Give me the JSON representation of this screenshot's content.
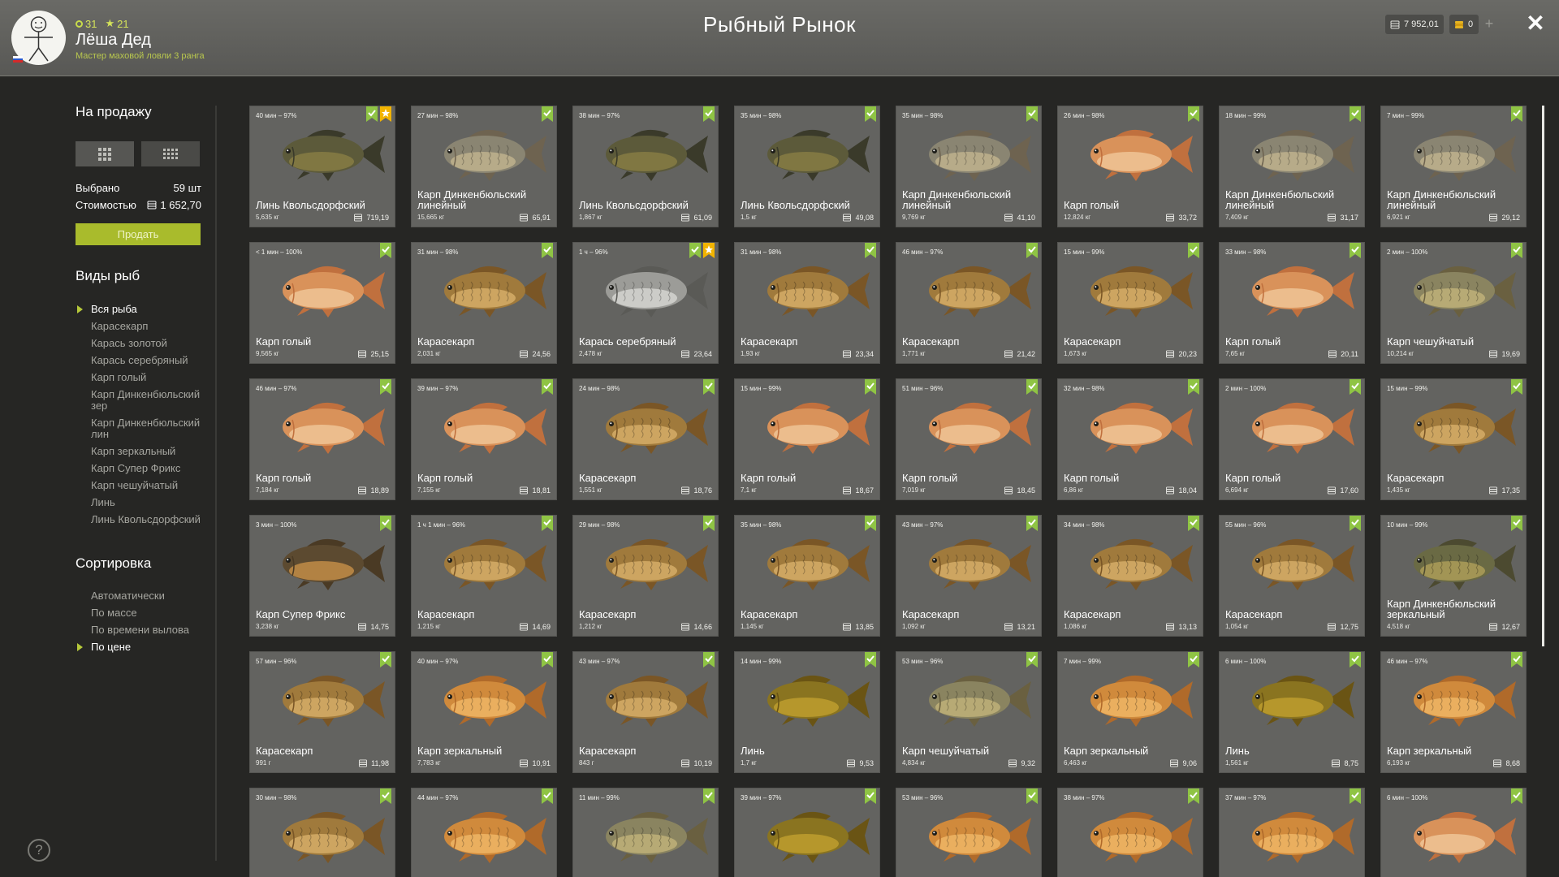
{
  "player": {
    "level": "31",
    "stars": "21",
    "name": "Лёша Дед",
    "rank": "Мастер маховой ловли 3 ранга"
  },
  "page_title": "Рыбный Рынок",
  "currency": {
    "money": "7 952,01",
    "gold": "0",
    "plus": "+"
  },
  "close": "✕",
  "sale": {
    "heading": "На продажу",
    "selected_label": "Выбрано",
    "selected_value": "59 шт",
    "cost_label": "Стоимостью",
    "cost_value": "1 652,70",
    "sell_label": "Продать"
  },
  "species": {
    "heading": "Виды рыб",
    "items": [
      "Вся рыба",
      "Карасекарп",
      "Карась золотой",
      "Карась серебряный",
      "Карп голый",
      "Карп Динкенбюльский зер",
      "Карп Динкенбюльский лин",
      "Карп зеркальный",
      "Карп Супер Фрикс",
      "Карп чешуйчатый",
      "Линь",
      "Линь Квольсдорфский"
    ],
    "active": "Вся рыба"
  },
  "sort": {
    "heading": "Сортировка",
    "items": [
      "Автоматически",
      "По массе",
      "По времени вылова",
      "По цене"
    ],
    "active": "По цене"
  },
  "help": "?",
  "icons": {
    "coin": "coin-stack-icon",
    "bookmark": "green-bookmark-icon",
    "favorite": "gold-star-bookmark-icon",
    "help": "help-icon",
    "close": "close-icon"
  },
  "colors": {
    "accent_green": "#a9bb2c",
    "bookmark_green": "#8fc444",
    "favorite_gold": "#f2b400",
    "card_bg": "#636360"
  },
  "fish": [
    {
      "age": "40 мин – 97%",
      "name": "Линь Квольсдорфский",
      "weight": "5,635 кг",
      "price": "719,19",
      "kind": "tench",
      "fav": true
    },
    {
      "age": "27 мин – 98%",
      "name": "Карп Динкенбюльский линейный",
      "weight": "15,665 кг",
      "price": "65,91",
      "kind": "mirrorgray",
      "fav": false
    },
    {
      "age": "38 мин – 97%",
      "name": "Линь Квольсдорфский",
      "weight": "1,867 кг",
      "price": "61,09",
      "kind": "tench",
      "fav": false
    },
    {
      "age": "35 мин – 98%",
      "name": "Линь Квольсдорфский",
      "weight": "1,5 кг",
      "price": "49,08",
      "kind": "tench",
      "fav": false
    },
    {
      "age": "35 мин – 98%",
      "name": "Карп Динкенбюльский линейный",
      "weight": "9,769 кг",
      "price": "41,10",
      "kind": "mirrorgray",
      "fav": false
    },
    {
      "age": "26 мин – 98%",
      "name": "Карп голый",
      "weight": "12,824 кг",
      "price": "33,72",
      "kind": "naked",
      "fav": false
    },
    {
      "age": "18 мин – 99%",
      "name": "Карп Динкенбюльский линейный",
      "weight": "7,409 кг",
      "price": "31,17",
      "kind": "mirrorgray",
      "fav": false
    },
    {
      "age": "7 мин – 99%",
      "name": "Карп Динкенбюльский линейный",
      "weight": "6,921 кг",
      "price": "29,12",
      "kind": "mirrorgray",
      "fav": false
    },
    {
      "age": "< 1 мин – 100%",
      "name": "Карп голый",
      "weight": "9,565 кг",
      "price": "25,15",
      "kind": "naked",
      "fav": false
    },
    {
      "age": "31 мин – 98%",
      "name": "Карасекарп",
      "weight": "2,031 кг",
      "price": "24,56",
      "kind": "crucian",
      "fav": false
    },
    {
      "age": "1 ч – 96%",
      "name": "Карась серебряный",
      "weight": "2,478 кг",
      "price": "23,64",
      "kind": "silver",
      "fav": true
    },
    {
      "age": "31 мин – 98%",
      "name": "Карасекарп",
      "weight": "1,93 кг",
      "price": "23,34",
      "kind": "crucian",
      "fav": false
    },
    {
      "age": "46 мин – 97%",
      "name": "Карасекарп",
      "weight": "1,771 кг",
      "price": "21,42",
      "kind": "crucian",
      "fav": false
    },
    {
      "age": "15 мин – 99%",
      "name": "Карасекарп",
      "weight": "1,673 кг",
      "price": "20,23",
      "kind": "crucian",
      "fav": false
    },
    {
      "age": "33 мин – 98%",
      "name": "Карп голый",
      "weight": "7,65 кг",
      "price": "20,11",
      "kind": "naked",
      "fav": false
    },
    {
      "age": "2 мин – 100%",
      "name": "Карп чешуйчатый",
      "weight": "10,214 кг",
      "price": "19,69",
      "kind": "common",
      "fav": false
    },
    {
      "age": "46 мин – 97%",
      "name": "Карп голый",
      "weight": "7,184 кг",
      "price": "18,89",
      "kind": "naked",
      "fav": false
    },
    {
      "age": "39 мин – 97%",
      "name": "Карп голый",
      "weight": "7,155 кг",
      "price": "18,81",
      "kind": "naked",
      "fav": false
    },
    {
      "age": "24 мин – 98%",
      "name": "Карасекарп",
      "weight": "1,551 кг",
      "price": "18,76",
      "kind": "crucian",
      "fav": false
    },
    {
      "age": "15 мин – 99%",
      "name": "Карп голый",
      "weight": "7,1 кг",
      "price": "18,67",
      "kind": "naked",
      "fav": false
    },
    {
      "age": "51 мин – 96%",
      "name": "Карп голый",
      "weight": "7,019 кг",
      "price": "18,45",
      "kind": "naked",
      "fav": false
    },
    {
      "age": "32 мин – 98%",
      "name": "Карп голый",
      "weight": "6,86 кг",
      "price": "18,04",
      "kind": "naked",
      "fav": false
    },
    {
      "age": "2 мин – 100%",
      "name": "Карп голый",
      "weight": "6,694 кг",
      "price": "17,60",
      "kind": "naked",
      "fav": false
    },
    {
      "age": "15 мин – 99%",
      "name": "Карасекарп",
      "weight": "1,435 кг",
      "price": "17,35",
      "kind": "crucian",
      "fav": false
    },
    {
      "age": "3 мин – 100%",
      "name": "Карп Супер Фрикс",
      "weight": "3,238 кг",
      "price": "14,75",
      "kind": "frix",
      "fav": false
    },
    {
      "age": "1 ч 1 мин – 96%",
      "name": "Карасекарп",
      "weight": "1,215 кг",
      "price": "14,69",
      "kind": "crucian",
      "fav": false
    },
    {
      "age": "29 мин – 98%",
      "name": "Карасекарп",
      "weight": "1,212 кг",
      "price": "14,66",
      "kind": "crucian",
      "fav": false
    },
    {
      "age": "35 мин – 98%",
      "name": "Карасекарп",
      "weight": "1,145 кг",
      "price": "13,85",
      "kind": "crucian",
      "fav": false
    },
    {
      "age": "43 мин – 97%",
      "name": "Карасекарп",
      "weight": "1,092 кг",
      "price": "13,21",
      "kind": "crucian",
      "fav": false
    },
    {
      "age": "34 мин – 98%",
      "name": "Карасекарп",
      "weight": "1,086 кг",
      "price": "13,13",
      "kind": "crucian",
      "fav": false
    },
    {
      "age": "55 мин – 96%",
      "name": "Карасекарп",
      "weight": "1,054 кг",
      "price": "12,75",
      "kind": "crucian",
      "fav": false
    },
    {
      "age": "10 мин – 99%",
      "name": "Карп Динкенбюльский зеркальный",
      "weight": "4,518 кг",
      "price": "12,67",
      "kind": "dinkmirror",
      "fav": false
    },
    {
      "age": "57 мин – 96%",
      "name": "Карасекарп",
      "weight": "991 г",
      "price": "11,98",
      "kind": "crucian",
      "fav": false
    },
    {
      "age": "40 мин – 97%",
      "name": "Карп зеркальный",
      "weight": "7,783 кг",
      "price": "10,91",
      "kind": "mirror",
      "fav": false
    },
    {
      "age": "43 мин – 97%",
      "name": "Карасекарп",
      "weight": "843 г",
      "price": "10,19",
      "kind": "crucian",
      "fav": false
    },
    {
      "age": "14 мин – 99%",
      "name": "Линь",
      "weight": "1,7 кг",
      "price": "9,53",
      "kind": "linh",
      "fav": false
    },
    {
      "age": "53 мин – 96%",
      "name": "Карп чешуйчатый",
      "weight": "4,834 кг",
      "price": "9,32",
      "kind": "common",
      "fav": false
    },
    {
      "age": "7 мин – 99%",
      "name": "Карп зеркальный",
      "weight": "6,463 кг",
      "price": "9,06",
      "kind": "mirror",
      "fav": false
    },
    {
      "age": "6 мин – 100%",
      "name": "Линь",
      "weight": "1,561 кг",
      "price": "8,75",
      "kind": "linh",
      "fav": false
    },
    {
      "age": "46 мин – 97%",
      "name": "Карп зеркальный",
      "weight": "6,193 кг",
      "price": "8,68",
      "kind": "mirror",
      "fav": false
    },
    {
      "age": "30 мин – 98%",
      "name": "",
      "weight": "",
      "price": "",
      "kind": "crucian",
      "fav": false
    },
    {
      "age": "44 мин – 97%",
      "name": "",
      "weight": "",
      "price": "",
      "kind": "mirror",
      "fav": false
    },
    {
      "age": "11 мин – 99%",
      "name": "",
      "weight": "",
      "price": "",
      "kind": "common",
      "fav": false
    },
    {
      "age": "39 мин – 97%",
      "name": "",
      "weight": "",
      "price": "",
      "kind": "linh",
      "fav": false
    },
    {
      "age": "53 мин – 96%",
      "name": "",
      "weight": "",
      "price": "",
      "kind": "mirror",
      "fav": false
    },
    {
      "age": "38 мин – 97%",
      "name": "",
      "weight": "",
      "price": "",
      "kind": "mirror",
      "fav": false
    },
    {
      "age": "37 мин – 97%",
      "name": "",
      "weight": "",
      "price": "",
      "kind": "mirror",
      "fav": false
    },
    {
      "age": "6 мин – 100%",
      "name": "",
      "weight": "",
      "price": "",
      "kind": "naked",
      "fav": false
    }
  ]
}
